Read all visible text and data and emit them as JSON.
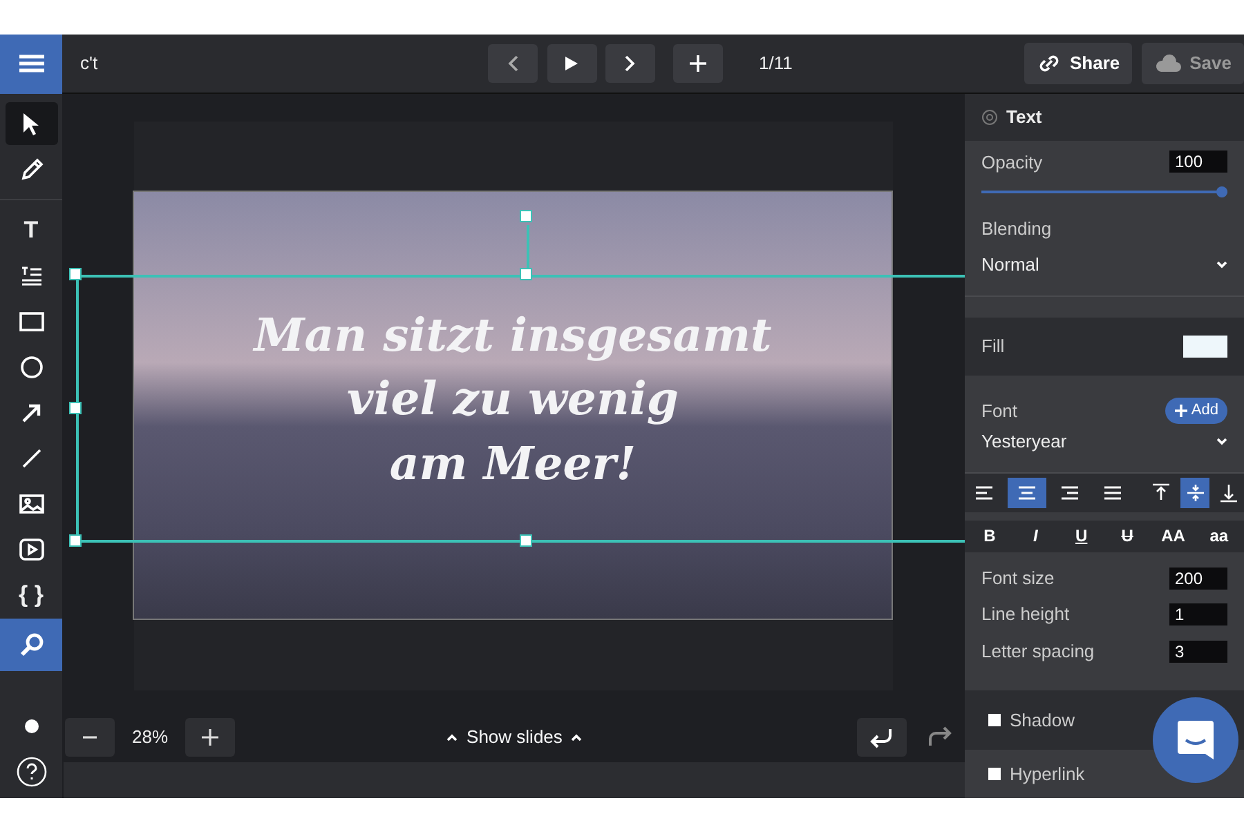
{
  "document_title": "c't",
  "nav": {
    "slide_counter": "1/11"
  },
  "actions": [
    {
      "kind": "share",
      "label": "Share",
      "disabled": false
    },
    {
      "kind": "save",
      "label": "Save",
      "disabled": true
    }
  ],
  "tools": [
    {
      "kind": "pointer",
      "selected": true
    },
    {
      "kind": "pencil",
      "selected": false
    },
    {
      "kind": "text",
      "label": "T",
      "selected": false
    },
    {
      "kind": "list",
      "selected": false
    },
    {
      "kind": "rectangle",
      "selected": false
    },
    {
      "kind": "circle",
      "selected": false
    },
    {
      "kind": "arrow",
      "selected": false
    },
    {
      "kind": "line",
      "selected": false
    },
    {
      "kind": "image",
      "selected": false
    },
    {
      "kind": "video",
      "selected": false
    },
    {
      "kind": "code",
      "label": "{ }",
      "selected": false
    }
  ],
  "search_tool": {
    "active": true
  },
  "slide": {
    "text_lines": [
      "Man sitzt insgesamt",
      "viel zu wenig",
      "am Meer!"
    ],
    "selected": true
  },
  "zoom": {
    "value": "28%"
  },
  "show_slides": "Show slides",
  "history": [
    {
      "kind": "undo",
      "disabled": false
    },
    {
      "kind": "redo",
      "disabled": true
    }
  ],
  "panel": {
    "title": "Text",
    "opacity": {
      "label": "Opacity",
      "value": "100",
      "level": 1
    },
    "blending": {
      "label": "Blending",
      "value": "Normal"
    },
    "fill": {
      "label": "Fill",
      "color": "#eef7fb"
    },
    "font": {
      "label": "Font",
      "add_label": "Add",
      "value": "Yesteryear"
    },
    "align": [
      {
        "kind": "left",
        "selected": false
      },
      {
        "kind": "center",
        "selected": true
      },
      {
        "kind": "right",
        "selected": false
      },
      {
        "kind": "justify",
        "selected": false
      }
    ],
    "valign": [
      {
        "kind": "top",
        "selected": false
      },
      {
        "kind": "middle",
        "selected": true
      },
      {
        "kind": "bottom",
        "selected": false
      }
    ],
    "styles": [
      {
        "kind": "bold",
        "label": "B"
      },
      {
        "kind": "italic",
        "label": "I"
      },
      {
        "kind": "underline",
        "label": "U"
      },
      {
        "kind": "strike",
        "label": "U"
      },
      {
        "kind": "upper",
        "label": "AA"
      },
      {
        "kind": "lower",
        "label": "aa"
      }
    ],
    "fields": [
      {
        "label": "Font size",
        "value": "200"
      },
      {
        "label": "Line height",
        "value": "1"
      },
      {
        "label": "Letter spacing",
        "value": "3"
      }
    ],
    "toggles": [
      {
        "label": "Shadow",
        "checked": false
      },
      {
        "label": "Hyperlink",
        "checked": false
      }
    ]
  }
}
